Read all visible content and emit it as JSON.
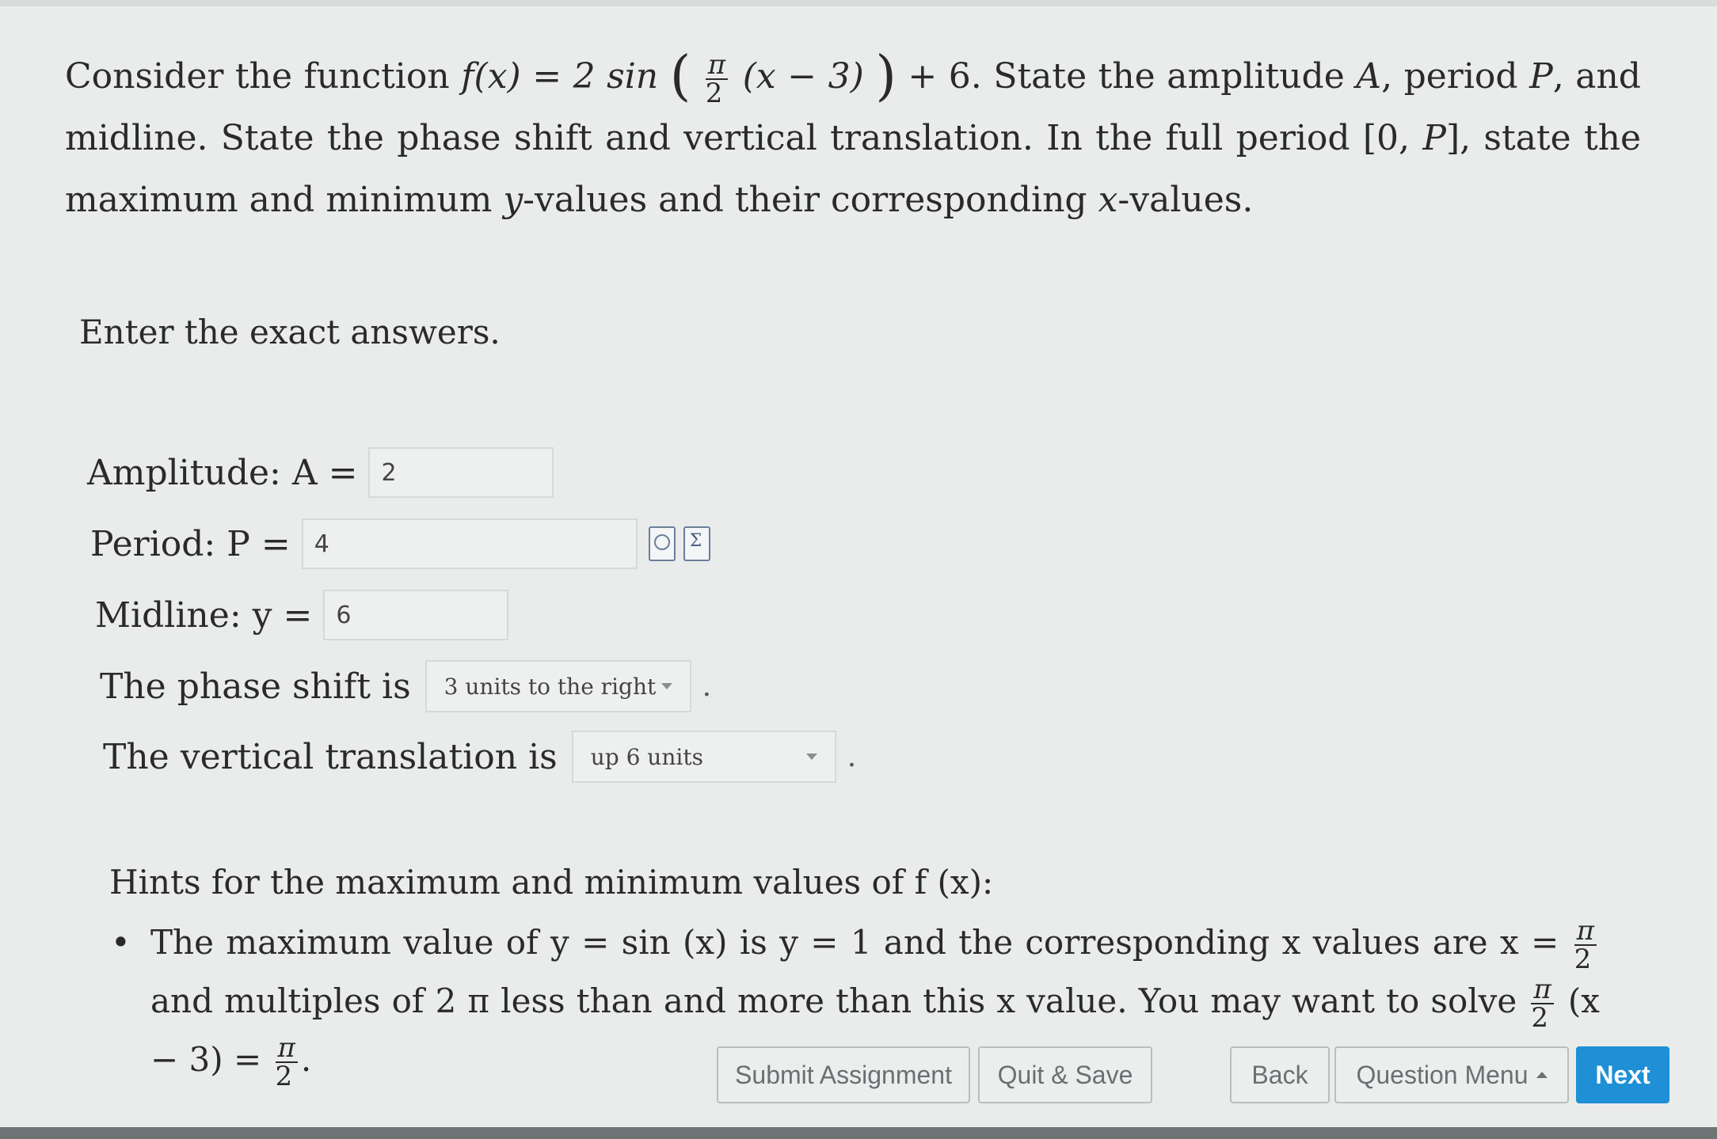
{
  "question": {
    "p1": "Consider the function ",
    "func": "f(x) = 2 sin",
    "frac_num": "π",
    "frac_den": "2",
    "arg": "(x − 3)",
    "func_tail": " + 6.",
    "p2": " State the amplitude ",
    "A": "A",
    "p3": ", period ",
    "P": "P",
    "p4": ", and midline. State the phase shift and vertical translation. In the full period [0, ",
    "P2": "P",
    "p5": "], state the maximum and minimum ",
    "y": "y",
    "p6": "-values and their corresponding ",
    "x": "x",
    "p7": "-values."
  },
  "instructions": "Enter the exact answers.",
  "fields": {
    "amplitude_label": "Amplitude: A =",
    "amplitude_value": "2",
    "period_label": "Period: P =",
    "period_value": "4",
    "midline_label": "Midline: y =",
    "midline_value": "6",
    "phase_label": "The phase shift is",
    "phase_value": "3 units to the right",
    "vertical_label": "The vertical translation is",
    "vertical_value": "up 6 units",
    "period_dot": ".",
    "vertical_dot": "."
  },
  "hints": {
    "title": "Hints for the maximum and minimum values of f (x):",
    "b1": "The maximum value of y = sin (x) is y = 1 and the corresponding x values are x = ",
    "b1_frac_num": "π",
    "b1_frac_den": "2",
    "b2": " and multiples of 2 π less than and more than this x value. You may want to solve ",
    "b2_frac_num": "π",
    "b2_frac_den": "2",
    "b3": " (x − 3) = ",
    "b3_frac_num": "π",
    "b3_frac_den": "2",
    "b4": "."
  },
  "buttons": {
    "submit": "Submit Assignment",
    "quit": "Quit & Save",
    "back": "Back",
    "menu": "Question Menu",
    "next": "Next"
  },
  "icons": {
    "preview": "magnifier-preview-icon",
    "formula": "sigma-formula-icon"
  }
}
